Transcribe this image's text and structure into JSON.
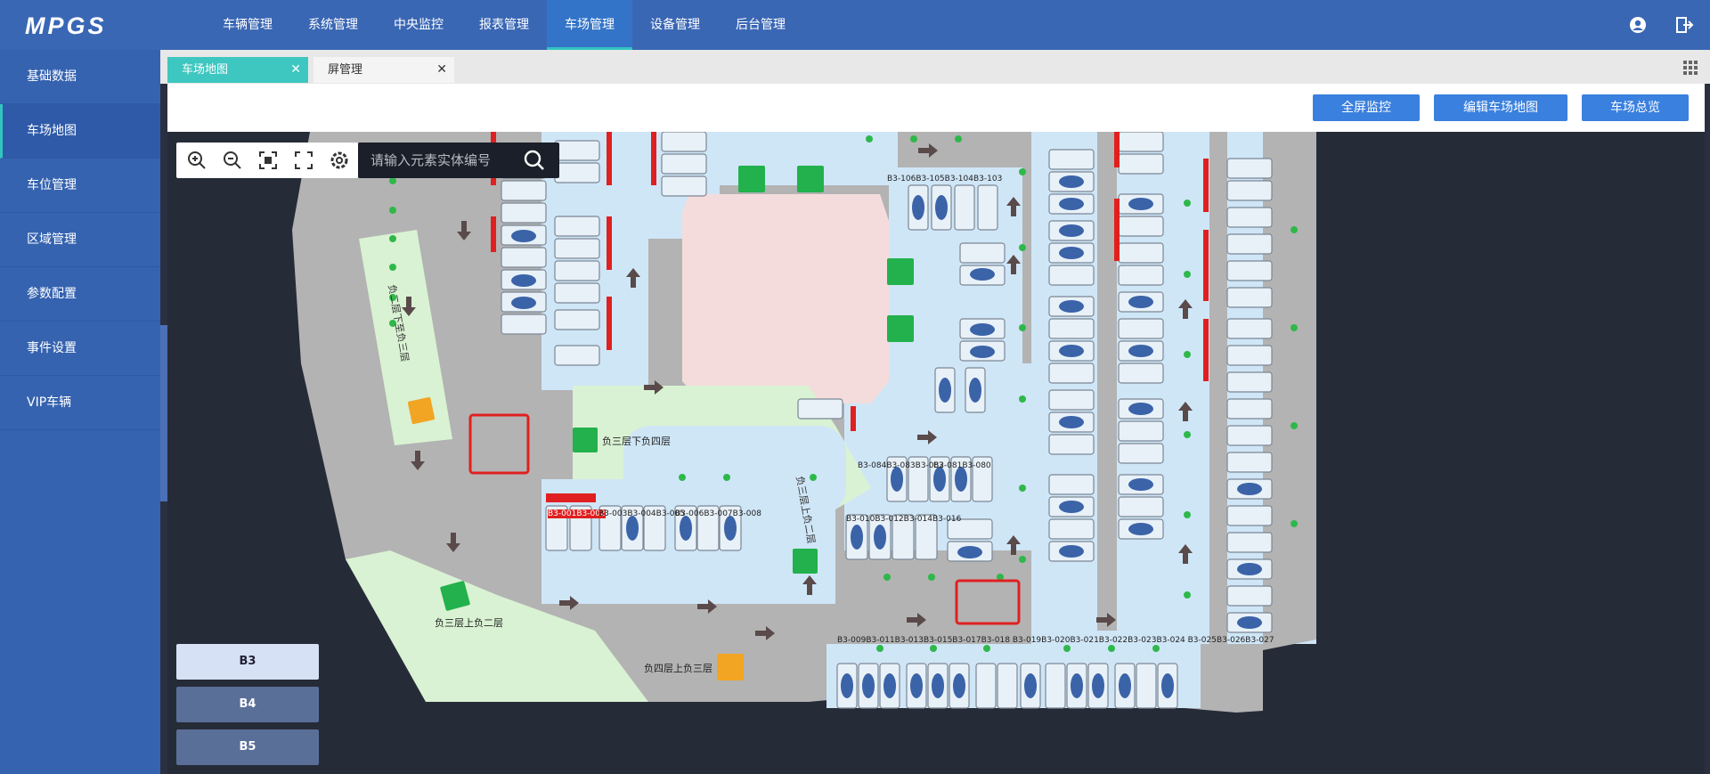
{
  "app": {
    "logo": "MPGS"
  },
  "nav": {
    "items": [
      "车辆管理",
      "系统管理",
      "中央监控",
      "报表管理",
      "车场管理",
      "设备管理",
      "后台管理"
    ],
    "active_index": 4
  },
  "top_icons": [
    "user-icon",
    "logout-icon"
  ],
  "sidebar": {
    "items": [
      "基础数据",
      "车场地图",
      "车位管理",
      "区域管理",
      "参数配置",
      "事件设置",
      "VIP车辆"
    ],
    "active_index": 1,
    "collapse_glyph": "《"
  },
  "tabs": [
    {
      "label": "车场地图",
      "close": "✕",
      "active": true
    },
    {
      "label": "屏管理",
      "close": "✕",
      "active": false
    }
  ],
  "toolbar": {
    "buttons": [
      "全屏监控",
      "编辑车场地图",
      "车场总览"
    ]
  },
  "map": {
    "search_placeholder": "请输入元素实体编号",
    "tools": [
      "zoom-in-icon",
      "zoom-out-icon",
      "fit-icon",
      "fullscreen-icon",
      "settings-icon"
    ],
    "floors": [
      "B3",
      "B4",
      "B5"
    ],
    "active_floor": "B3",
    "labels": {
      "ramp_b2_to_b3": "负二层下至负三层",
      "ramp_b3_down_b4": "负三层下负四层",
      "ramp_b3_up_b2_mid": "负三层上负二层",
      "ramp_b3_up_b2_left": "负三层上负二层",
      "ramp_b4_up_b3": "负四层上负三层",
      "row_top_mid": "B3-106B3-105B3-104B3-103",
      "row_mid_a": "B3-084B3-083B3-082",
      "row_mid_b": "B3-081B3-080",
      "row_left_1": "B3-001B3-002",
      "row_left_2": "B3-003B3-004B3-005",
      "row_left_3": "B3-006B3-007B3-008",
      "row_mid_c": "B3-010B3-012B3-014B3-016",
      "row_bottom": "B3-009B3-011B3-013B3-015B3-017B3-018 B3-019B3-020B3-021B3-022B3-023B3-024 B3-025B3-026B3-027"
    },
    "colors": {
      "road": "#b3b3b3",
      "spot_area": "#cfe6f7",
      "green_zone": "#d9f2d3",
      "pink_zone": "#f5dcdc",
      "exit_green": "#22b14c",
      "highlight_red": "#e02020",
      "ramp_orange": "#f2a423"
    }
  }
}
